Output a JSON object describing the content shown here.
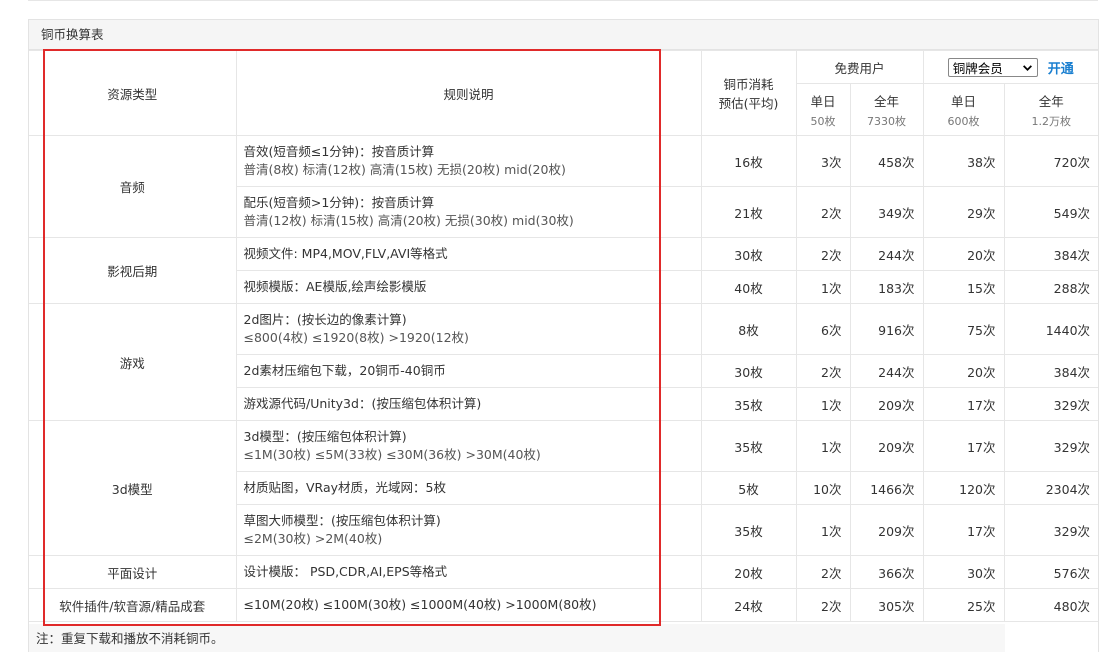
{
  "caption": "铜币换算表",
  "headers": {
    "resource_type": "资源类型",
    "rule": "规则说明",
    "cost_line1": "铜币消耗",
    "cost_line2": "预估(平均)",
    "free_user": "免费用户",
    "member_select": "铜牌会员",
    "open": "开通",
    "cols": [
      {
        "label": "单日",
        "sub": "50枚"
      },
      {
        "label": "全年",
        "sub": "7330枚"
      },
      {
        "label": "单日",
        "sub": "600枚"
      },
      {
        "label": "全年",
        "sub": "1.2万枚"
      }
    ]
  },
  "groups": [
    {
      "name": "音频",
      "rows": [
        {
          "l1": "音效(短音频≤1分钟)：按音质计算",
          "l2": "普清(8枚)   标清(12枚)   高清(15枚)   无损(20枚)   mid(20枚)",
          "cost": "16枚",
          "c1": "3次",
          "c2": "458次",
          "c3": "38次",
          "c4": "720次"
        },
        {
          "l1": "配乐(短音频>1分钟)：按音质计算",
          "l2": "普清(12枚)   标清(15枚)   高清(20枚)   无损(30枚)   mid(30枚)",
          "cost": "21枚",
          "c1": "2次",
          "c2": "349次",
          "c3": "29次",
          "c4": "549次"
        }
      ]
    },
    {
      "name": "影视后期",
      "rows": [
        {
          "l1": "视频文件: MP4,MOV,FLV,AVI等格式",
          "l2": "",
          "cost": "30枚",
          "c1": "2次",
          "c2": "244次",
          "c3": "20次",
          "c4": "384次"
        },
        {
          "l1": "视频模版：AE模版,绘声绘影模版",
          "l2": "",
          "cost": "40枚",
          "c1": "1次",
          "c2": "183次",
          "c3": "15次",
          "c4": "288次"
        }
      ]
    },
    {
      "name": "游戏",
      "rows": [
        {
          "l1": "2d图片：(按长边的像素计算)",
          "l2": "≤800(4枚)   ≤1920(8枚)   >1920(12枚)",
          "cost": "8枚",
          "c1": "6次",
          "c2": "916次",
          "c3": "75次",
          "c4": "1440次"
        },
        {
          "l1": "2d素材压缩包下载，20铜币-40铜币",
          "l2": "",
          "cost": "30枚",
          "c1": "2次",
          "c2": "244次",
          "c3": "20次",
          "c4": "384次"
        },
        {
          "l1": "游戏源代码/Unity3d：(按压缩包体积计算)",
          "l2": "",
          "cost": "35枚",
          "c1": "1次",
          "c2": "209次",
          "c3": "17次",
          "c4": "329次"
        }
      ]
    },
    {
      "name": "3d模型",
      "rows": [
        {
          "l1": "3d模型：(按压缩包体积计算)",
          "l2": "≤1M(30枚)   ≤5M(33枚)   ≤30M(36枚)   >30M(40枚)",
          "cost": "35枚",
          "c1": "1次",
          "c2": "209次",
          "c3": "17次",
          "c4": "329次"
        },
        {
          "l1": "材质贴图，VRay材质，光域网：5枚",
          "l2": "",
          "cost": "5枚",
          "c1": "10次",
          "c2": "1466次",
          "c3": "120次",
          "c4": "2304次"
        },
        {
          "l1": "草图大师模型：(按压缩包体积计算)",
          "l2": "≤2M(30枚)   >2M(40枚)",
          "cost": "35枚",
          "c1": "1次",
          "c2": "209次",
          "c3": "17次",
          "c4": "329次"
        }
      ]
    },
    {
      "name": "平面设计",
      "rows": [
        {
          "l1": "设计模版： PSD,CDR,AI,EPS等格式",
          "l2": "",
          "cost": "20枚",
          "c1": "2次",
          "c2": "366次",
          "c3": "30次",
          "c4": "576次"
        }
      ]
    },
    {
      "name": "软件插件/软音源/精品成套",
      "rows": [
        {
          "l1": "≤10M(20枚)   ≤100M(30枚)   ≤1000M(40枚)   >1000M(80枚)",
          "l2": "",
          "cost": "24枚",
          "c1": "2次",
          "c2": "305次",
          "c3": "25次",
          "c4": "480次"
        }
      ]
    }
  ],
  "note": "注：重复下载和播放不消耗铜币。",
  "colors": {
    "highlight": "#e02a2a",
    "link": "#1a7fd0"
  }
}
